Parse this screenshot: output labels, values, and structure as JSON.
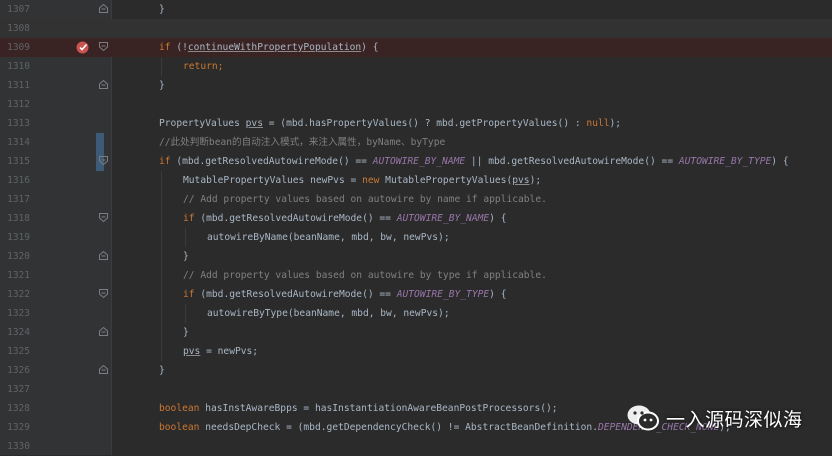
{
  "editor": {
    "lines": [
      {
        "num": "1307",
        "indent": 0,
        "tokens": [
          {
            "t": "}",
            "c": ""
          }
        ],
        "fold": "end"
      },
      {
        "num": "1308",
        "indent": 0,
        "tokens": [],
        "current": true
      },
      {
        "num": "1309",
        "indent": 0,
        "breakpoint": true,
        "fold": "start",
        "tokens": [
          {
            "t": "if",
            "c": "kw"
          },
          {
            "t": " (!",
            "c": ""
          },
          {
            "t": "continueWithPropertyPopulation",
            "c": "ul"
          },
          {
            "t": ") {",
            "c": ""
          }
        ]
      },
      {
        "num": "1310",
        "indent": 1,
        "tokens": [
          {
            "t": "return;",
            "c": "kw"
          }
        ]
      },
      {
        "num": "1311",
        "indent": 0,
        "fold": "end",
        "tokens": [
          {
            "t": "}",
            "c": ""
          }
        ]
      },
      {
        "num": "1312",
        "indent": 0,
        "tokens": []
      },
      {
        "num": "1313",
        "indent": 0,
        "tokens": [
          {
            "t": "PropertyValues ",
            "c": ""
          },
          {
            "t": "pvs",
            "c": "ul"
          },
          {
            "t": " = (mbd.hasPropertyValues() ? mbd.getPropertyValues() : ",
            "c": ""
          },
          {
            "t": "null",
            "c": "kw"
          },
          {
            "t": ");",
            "c": ""
          }
        ]
      },
      {
        "num": "1314",
        "indent": 0,
        "marker": true,
        "tokens": [
          {
            "t": "//此处判断bean的自动注入模式，来注入属性，byName、byType",
            "c": "cm"
          }
        ]
      },
      {
        "num": "1315",
        "indent": 0,
        "marker": true,
        "fold": "start",
        "tokens": [
          {
            "t": "if",
            "c": "kw"
          },
          {
            "t": " (mbd.getResolvedAutowireMode() == ",
            "c": ""
          },
          {
            "t": "AUTOWIRE_BY_NAME",
            "c": "fld"
          },
          {
            "t": " || mbd.getResolvedAutowireMode() == ",
            "c": ""
          },
          {
            "t": "AUTOWIRE_BY_TYPE",
            "c": "fld"
          },
          {
            "t": ") {",
            "c": ""
          }
        ]
      },
      {
        "num": "1316",
        "indent": 1,
        "tokens": [
          {
            "t": "MutablePropertyValues newPvs = ",
            "c": ""
          },
          {
            "t": "new",
            "c": "kw"
          },
          {
            "t": " MutablePropertyValues(",
            "c": ""
          },
          {
            "t": "pvs",
            "c": "ul"
          },
          {
            "t": ");",
            "c": ""
          }
        ]
      },
      {
        "num": "1317",
        "indent": 1,
        "tokens": [
          {
            "t": "// Add property values based on autowire by name if applicable.",
            "c": "cm"
          }
        ]
      },
      {
        "num": "1318",
        "indent": 1,
        "fold": "start",
        "tokens": [
          {
            "t": "if",
            "c": "kw"
          },
          {
            "t": " (mbd.getResolvedAutowireMode() == ",
            "c": ""
          },
          {
            "t": "AUTOWIRE_BY_NAME",
            "c": "fld"
          },
          {
            "t": ") {",
            "c": ""
          }
        ]
      },
      {
        "num": "1319",
        "indent": 2,
        "tokens": [
          {
            "t": "autowireByName(beanName, mbd, bw, newPvs);",
            "c": ""
          }
        ]
      },
      {
        "num": "1320",
        "indent": 1,
        "fold": "end",
        "tokens": [
          {
            "t": "}",
            "c": ""
          }
        ]
      },
      {
        "num": "1321",
        "indent": 1,
        "tokens": [
          {
            "t": "// Add property values based on autowire by type if applicable.",
            "c": "cm"
          }
        ]
      },
      {
        "num": "1322",
        "indent": 1,
        "fold": "start",
        "tokens": [
          {
            "t": "if",
            "c": "kw"
          },
          {
            "t": " (mbd.getResolvedAutowireMode() == ",
            "c": ""
          },
          {
            "t": "AUTOWIRE_BY_TYPE",
            "c": "fld"
          },
          {
            "t": ") {",
            "c": ""
          }
        ]
      },
      {
        "num": "1323",
        "indent": 2,
        "tokens": [
          {
            "t": "autowireByType(beanName, mbd, bw, newPvs);",
            "c": ""
          }
        ]
      },
      {
        "num": "1324",
        "indent": 1,
        "fold": "end",
        "tokens": [
          {
            "t": "}",
            "c": ""
          }
        ]
      },
      {
        "num": "1325",
        "indent": 1,
        "tokens": [
          {
            "t": "pvs",
            "c": "ul"
          },
          {
            "t": " = newPvs;",
            "c": ""
          }
        ]
      },
      {
        "num": "1326",
        "indent": 0,
        "fold": "end",
        "tokens": [
          {
            "t": "}",
            "c": ""
          }
        ]
      },
      {
        "num": "1327",
        "indent": 0,
        "tokens": []
      },
      {
        "num": "1328",
        "indent": 0,
        "tokens": [
          {
            "t": "boolean",
            "c": "kw"
          },
          {
            "t": " hasInstAwareBpps = hasInstantiationAwareBeanPostProcessors();",
            "c": ""
          }
        ]
      },
      {
        "num": "1329",
        "indent": 0,
        "tokens": [
          {
            "t": "boolean",
            "c": "kw"
          },
          {
            "t": " needsDepCheck = (mbd.getDependencyCheck() != AbstractBeanDefinition.",
            "c": ""
          },
          {
            "t": "DEPENDENCY_CHECK_NONE",
            "c": "fld"
          },
          {
            "t": ");",
            "c": ""
          }
        ]
      },
      {
        "num": "1330",
        "indent": 0,
        "tokens": []
      }
    ]
  },
  "colors": {
    "background": "#2b2b2b",
    "gutter": "#313335",
    "keyword": "#cc7832",
    "field": "#9876aa",
    "comment": "#808080",
    "text": "#a9b7c6",
    "breakpoint": "#c75450"
  },
  "icons": {
    "breakpoint": "breakpoint-check-icon",
    "fold": "fold-marker-icon",
    "watermark": "wechat-icon"
  },
  "watermark": {
    "text": "一入源码深似海"
  }
}
